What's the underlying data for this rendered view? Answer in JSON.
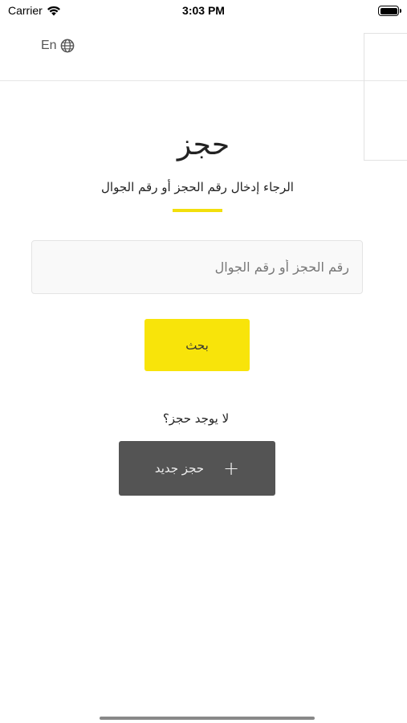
{
  "status_bar": {
    "carrier": "Carrier",
    "time": "3:03 PM",
    "wifi_icon": "wifi-icon",
    "battery_icon": "battery-icon"
  },
  "header": {
    "language_label": "En",
    "language_icon": "globe-icon"
  },
  "page": {
    "title": "حجز",
    "subtitle": "الرجاء إدخال رقم الحجز أو رقم الجوال",
    "accent_color": "#f8e40a"
  },
  "search": {
    "placeholder": "رقم الحجز أو رقم الجوال",
    "value": "",
    "button_label": "بحث"
  },
  "new_booking": {
    "prompt": "لا يوجد حجز؟",
    "button_label": "حجز جديد",
    "button_icon": "plus-icon",
    "button_color": "#545454"
  }
}
